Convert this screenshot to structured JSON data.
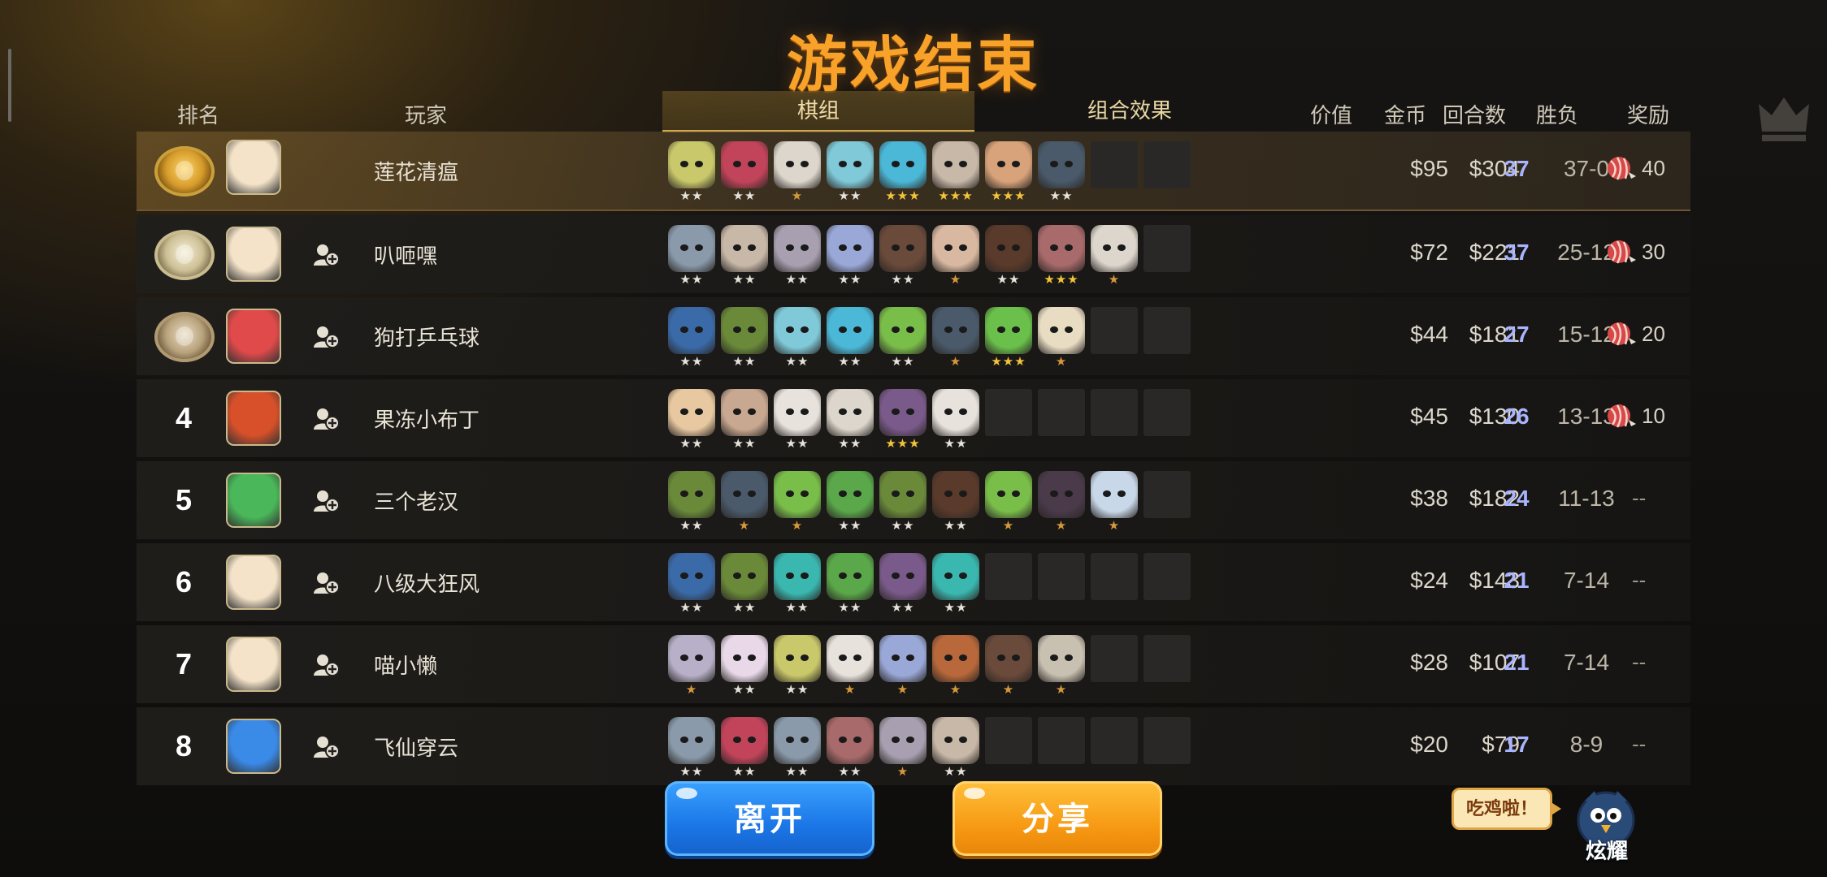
{
  "title": "游戏结束",
  "headers": {
    "rank": "排名",
    "player": "玩家",
    "tab_board": "棋组",
    "tab_synergy": "组合效果",
    "value": "价值",
    "gold": "金币",
    "rounds": "回合数",
    "record": "胜负",
    "reward": "奖励"
  },
  "players": [
    {
      "rank": "1",
      "medal": "gold",
      "name": "莲花清瘟",
      "value": "$95",
      "gold": "$304",
      "rounds": "37",
      "record": "37-0",
      "reward": "40",
      "has_reward": true,
      "avatar_color": "#f4e3c8",
      "friend": false,
      "units": [
        {
          "c": "#c9c86a",
          "s": "★★"
        },
        {
          "c": "#c2445a",
          "s": "★★"
        },
        {
          "c": "#dcd6cc",
          "s": "★"
        },
        {
          "c": "#7fc9d8",
          "s": "★★"
        },
        {
          "c": "#4bb8d8",
          "s": "★★★"
        },
        {
          "c": "#c8b8a8",
          "s": "★★★"
        },
        {
          "c": "#d8a27a",
          "s": "★★★"
        },
        {
          "c": "#4a5a6a",
          "s": "★★"
        }
      ],
      "empty": 2
    },
    {
      "rank": "2",
      "medal": "silver",
      "name": "叭咂嘿",
      "value": "$72",
      "gold": "$221",
      "rounds": "37",
      "record": "25-12",
      "reward": "30",
      "has_reward": true,
      "avatar_color": "#f4e3c8",
      "friend": true,
      "units": [
        {
          "c": "#8a9aaa",
          "s": "★★"
        },
        {
          "c": "#c8b8a8",
          "s": "★★"
        },
        {
          "c": "#a8a0b0",
          "s": "★★"
        },
        {
          "c": "#9aa8d8",
          "s": "★★"
        },
        {
          "c": "#6a4a3a",
          "s": "★★"
        },
        {
          "c": "#d8b8a0",
          "s": "★"
        },
        {
          "c": "#5a3a2a",
          "s": "★★"
        },
        {
          "c": "#a86a6a",
          "s": "★★★"
        },
        {
          "c": "#dcd6cc",
          "s": "★"
        }
      ],
      "empty": 1
    },
    {
      "rank": "3",
      "medal": "bronze",
      "name": "狗打乒乓球",
      "value": "$44",
      "gold": "$181",
      "rounds": "27",
      "record": "15-12",
      "reward": "20",
      "has_reward": true,
      "avatar_color": "#e04a4a",
      "friend": true,
      "units": [
        {
          "c": "#3a6aa8",
          "s": "★★"
        },
        {
          "c": "#6a8a3a",
          "s": "★★"
        },
        {
          "c": "#7fc9d8",
          "s": "★★"
        },
        {
          "c": "#4bb8d8",
          "s": "★★"
        },
        {
          "c": "#7abe4a",
          "s": "★★"
        },
        {
          "c": "#4a5a6a",
          "s": "★"
        },
        {
          "c": "#6ac04a",
          "s": "★★★"
        },
        {
          "c": "#e8dcc2",
          "s": "★"
        }
      ],
      "empty": 2
    },
    {
      "rank": "4",
      "medal": "",
      "name": "果冻小布丁",
      "value": "$45",
      "gold": "$130",
      "rounds": "26",
      "record": "13-13",
      "reward": "10",
      "has_reward": true,
      "avatar_color": "#d8502a",
      "friend": true,
      "units": [
        {
          "c": "#e8c8a0",
          "s": "★★"
        },
        {
          "c": "#c8a890",
          "s": "★★"
        },
        {
          "c": "#e8e2dc",
          "s": "★★"
        },
        {
          "c": "#dcd6cc",
          "s": "★★"
        },
        {
          "c": "#7a5a8a",
          "s": "★★★"
        },
        {
          "c": "#e8e2dc",
          "s": "★★"
        }
      ],
      "empty": 4
    },
    {
      "rank": "5",
      "medal": "",
      "name": "三个老汉",
      "value": "$38",
      "gold": "$182",
      "rounds": "24",
      "record": "11-13",
      "reward": "--",
      "has_reward": false,
      "avatar_color": "#4ab85a",
      "friend": true,
      "units": [
        {
          "c": "#6a8a3a",
          "s": "★★"
        },
        {
          "c": "#4a5a6a",
          "s": "★"
        },
        {
          "c": "#7abe4a",
          "s": "★"
        },
        {
          "c": "#5aa84a",
          "s": "★★"
        },
        {
          "c": "#6a8a3a",
          "s": "★★"
        },
        {
          "c": "#5a3a2a",
          "s": "★★"
        },
        {
          "c": "#7abe4a",
          "s": "★"
        },
        {
          "c": "#4a3a4a",
          "s": "★"
        },
        {
          "c": "#c8d8e8",
          "s": "★"
        }
      ],
      "empty": 1
    },
    {
      "rank": "6",
      "medal": "",
      "name": "八级大狂风",
      "value": "$24",
      "gold": "$143",
      "rounds": "21",
      "record": "7-14",
      "reward": "--",
      "has_reward": false,
      "avatar_color": "#f4e3c8",
      "friend": true,
      "units": [
        {
          "c": "#3a6aa8",
          "s": "★★"
        },
        {
          "c": "#6a8a3a",
          "s": "★★"
        },
        {
          "c": "#3ab8b0",
          "s": "★★"
        },
        {
          "c": "#5aa84a",
          "s": "★★"
        },
        {
          "c": "#7a5a8a",
          "s": "★★"
        },
        {
          "c": "#3ab8b0",
          "s": "★★"
        }
      ],
      "empty": 4
    },
    {
      "rank": "7",
      "medal": "",
      "name": "喵小懒",
      "value": "$28",
      "gold": "$107",
      "rounds": "21",
      "record": "7-14",
      "reward": "--",
      "has_reward": false,
      "avatar_color": "#f4e3c8",
      "friend": true,
      "units": [
        {
          "c": "#b8b0c8",
          "s": "★"
        },
        {
          "c": "#e8d8e8",
          "s": "★★"
        },
        {
          "c": "#c9c86a",
          "s": "★★"
        },
        {
          "c": "#e8e2dc",
          "s": "★"
        },
        {
          "c": "#9aa8d8",
          "s": "★"
        },
        {
          "c": "#b8683a",
          "s": "★"
        },
        {
          "c": "#6a4a3a",
          "s": "★"
        },
        {
          "c": "#c8c0b0",
          "s": "★"
        }
      ],
      "empty": 2
    },
    {
      "rank": "8",
      "medal": "",
      "name": "飞仙穿云",
      "value": "$20",
      "gold": "$79",
      "rounds": "17",
      "record": "8-9",
      "reward": "--",
      "has_reward": false,
      "avatar_color": "#3a8ae8",
      "friend": true,
      "units": [
        {
          "c": "#8a9aaa",
          "s": "★★"
        },
        {
          "c": "#c2445a",
          "s": "★★"
        },
        {
          "c": "#8a9aaa",
          "s": "★★"
        },
        {
          "c": "#a86a6a",
          "s": "★★"
        },
        {
          "c": "#a8a0b0",
          "s": "★"
        },
        {
          "c": "#c8b8a8",
          "s": "★★"
        }
      ],
      "empty": 4
    }
  ],
  "buttons": {
    "leave": "离开",
    "share": "分享"
  },
  "brag": {
    "bubble": "吃鸡啦！",
    "label": "炫耀"
  },
  "colors": {
    "title": "#f8a22a",
    "accent_blue": "#1b76e6",
    "accent_orange": "#f79a14",
    "round_text": "#a9b4ff"
  }
}
